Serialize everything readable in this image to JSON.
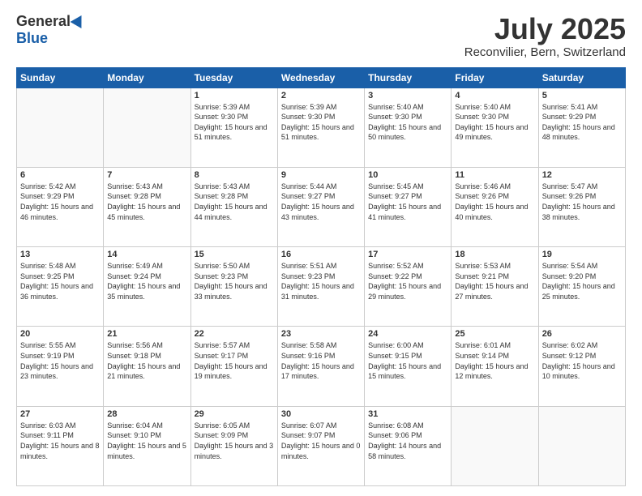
{
  "logo": {
    "general": "General",
    "blue": "Blue"
  },
  "title": {
    "month_year": "July 2025",
    "location": "Reconvilier, Bern, Switzerland"
  },
  "days_of_week": [
    "Sunday",
    "Monday",
    "Tuesday",
    "Wednesday",
    "Thursday",
    "Friday",
    "Saturday"
  ],
  "weeks": [
    [
      {
        "day": "",
        "sunrise": "",
        "sunset": "",
        "daylight": "",
        "empty": true
      },
      {
        "day": "",
        "sunrise": "",
        "sunset": "",
        "daylight": "",
        "empty": true
      },
      {
        "day": "1",
        "sunrise": "Sunrise: 5:39 AM",
        "sunset": "Sunset: 9:30 PM",
        "daylight": "Daylight: 15 hours and 51 minutes."
      },
      {
        "day": "2",
        "sunrise": "Sunrise: 5:39 AM",
        "sunset": "Sunset: 9:30 PM",
        "daylight": "Daylight: 15 hours and 51 minutes."
      },
      {
        "day": "3",
        "sunrise": "Sunrise: 5:40 AM",
        "sunset": "Sunset: 9:30 PM",
        "daylight": "Daylight: 15 hours and 50 minutes."
      },
      {
        "day": "4",
        "sunrise": "Sunrise: 5:40 AM",
        "sunset": "Sunset: 9:30 PM",
        "daylight": "Daylight: 15 hours and 49 minutes."
      },
      {
        "day": "5",
        "sunrise": "Sunrise: 5:41 AM",
        "sunset": "Sunset: 9:29 PM",
        "daylight": "Daylight: 15 hours and 48 minutes."
      }
    ],
    [
      {
        "day": "6",
        "sunrise": "Sunrise: 5:42 AM",
        "sunset": "Sunset: 9:29 PM",
        "daylight": "Daylight: 15 hours and 46 minutes."
      },
      {
        "day": "7",
        "sunrise": "Sunrise: 5:43 AM",
        "sunset": "Sunset: 9:28 PM",
        "daylight": "Daylight: 15 hours and 45 minutes."
      },
      {
        "day": "8",
        "sunrise": "Sunrise: 5:43 AM",
        "sunset": "Sunset: 9:28 PM",
        "daylight": "Daylight: 15 hours and 44 minutes."
      },
      {
        "day": "9",
        "sunrise": "Sunrise: 5:44 AM",
        "sunset": "Sunset: 9:27 PM",
        "daylight": "Daylight: 15 hours and 43 minutes."
      },
      {
        "day": "10",
        "sunrise": "Sunrise: 5:45 AM",
        "sunset": "Sunset: 9:27 PM",
        "daylight": "Daylight: 15 hours and 41 minutes."
      },
      {
        "day": "11",
        "sunrise": "Sunrise: 5:46 AM",
        "sunset": "Sunset: 9:26 PM",
        "daylight": "Daylight: 15 hours and 40 minutes."
      },
      {
        "day": "12",
        "sunrise": "Sunrise: 5:47 AM",
        "sunset": "Sunset: 9:26 PM",
        "daylight": "Daylight: 15 hours and 38 minutes."
      }
    ],
    [
      {
        "day": "13",
        "sunrise": "Sunrise: 5:48 AM",
        "sunset": "Sunset: 9:25 PM",
        "daylight": "Daylight: 15 hours and 36 minutes."
      },
      {
        "day": "14",
        "sunrise": "Sunrise: 5:49 AM",
        "sunset": "Sunset: 9:24 PM",
        "daylight": "Daylight: 15 hours and 35 minutes."
      },
      {
        "day": "15",
        "sunrise": "Sunrise: 5:50 AM",
        "sunset": "Sunset: 9:23 PM",
        "daylight": "Daylight: 15 hours and 33 minutes."
      },
      {
        "day": "16",
        "sunrise": "Sunrise: 5:51 AM",
        "sunset": "Sunset: 9:23 PM",
        "daylight": "Daylight: 15 hours and 31 minutes."
      },
      {
        "day": "17",
        "sunrise": "Sunrise: 5:52 AM",
        "sunset": "Sunset: 9:22 PM",
        "daylight": "Daylight: 15 hours and 29 minutes."
      },
      {
        "day": "18",
        "sunrise": "Sunrise: 5:53 AM",
        "sunset": "Sunset: 9:21 PM",
        "daylight": "Daylight: 15 hours and 27 minutes."
      },
      {
        "day": "19",
        "sunrise": "Sunrise: 5:54 AM",
        "sunset": "Sunset: 9:20 PM",
        "daylight": "Daylight: 15 hours and 25 minutes."
      }
    ],
    [
      {
        "day": "20",
        "sunrise": "Sunrise: 5:55 AM",
        "sunset": "Sunset: 9:19 PM",
        "daylight": "Daylight: 15 hours and 23 minutes."
      },
      {
        "day": "21",
        "sunrise": "Sunrise: 5:56 AM",
        "sunset": "Sunset: 9:18 PM",
        "daylight": "Daylight: 15 hours and 21 minutes."
      },
      {
        "day": "22",
        "sunrise": "Sunrise: 5:57 AM",
        "sunset": "Sunset: 9:17 PM",
        "daylight": "Daylight: 15 hours and 19 minutes."
      },
      {
        "day": "23",
        "sunrise": "Sunrise: 5:58 AM",
        "sunset": "Sunset: 9:16 PM",
        "daylight": "Daylight: 15 hours and 17 minutes."
      },
      {
        "day": "24",
        "sunrise": "Sunrise: 6:00 AM",
        "sunset": "Sunset: 9:15 PM",
        "daylight": "Daylight: 15 hours and 15 minutes."
      },
      {
        "day": "25",
        "sunrise": "Sunrise: 6:01 AM",
        "sunset": "Sunset: 9:14 PM",
        "daylight": "Daylight: 15 hours and 12 minutes."
      },
      {
        "day": "26",
        "sunrise": "Sunrise: 6:02 AM",
        "sunset": "Sunset: 9:12 PM",
        "daylight": "Daylight: 15 hours and 10 minutes."
      }
    ],
    [
      {
        "day": "27",
        "sunrise": "Sunrise: 6:03 AM",
        "sunset": "Sunset: 9:11 PM",
        "daylight": "Daylight: 15 hours and 8 minutes."
      },
      {
        "day": "28",
        "sunrise": "Sunrise: 6:04 AM",
        "sunset": "Sunset: 9:10 PM",
        "daylight": "Daylight: 15 hours and 5 minutes."
      },
      {
        "day": "29",
        "sunrise": "Sunrise: 6:05 AM",
        "sunset": "Sunset: 9:09 PM",
        "daylight": "Daylight: 15 hours and 3 minutes."
      },
      {
        "day": "30",
        "sunrise": "Sunrise: 6:07 AM",
        "sunset": "Sunset: 9:07 PM",
        "daylight": "Daylight: 15 hours and 0 minutes."
      },
      {
        "day": "31",
        "sunrise": "Sunrise: 6:08 AM",
        "sunset": "Sunset: 9:06 PM",
        "daylight": "Daylight: 14 hours and 58 minutes."
      },
      {
        "day": "",
        "sunrise": "",
        "sunset": "",
        "daylight": "",
        "empty": true
      },
      {
        "day": "",
        "sunrise": "",
        "sunset": "",
        "daylight": "",
        "empty": true
      }
    ]
  ]
}
